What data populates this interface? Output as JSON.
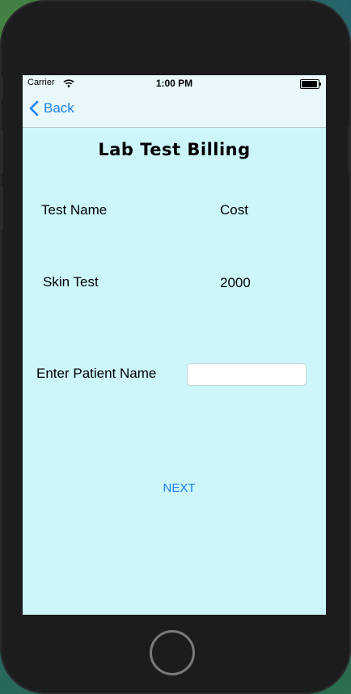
{
  "status_bar": {
    "carrier": "Carrier",
    "time": "1:00 PM"
  },
  "nav": {
    "back_label": "Back"
  },
  "screen": {
    "title": "Lab Test Billing",
    "headers": {
      "test_name": "Test Name",
      "cost": "Cost"
    },
    "row": {
      "test_name": "Skin Test",
      "cost": "2000"
    },
    "patient_label": "Enter Patient Name",
    "patient_input_value": "",
    "next_label": "NEXT"
  },
  "colors": {
    "accent": "#1a7ff2",
    "background": "#cdf6fb",
    "navbar": "#e9f8fa"
  },
  "icons": [
    "wifi-icon",
    "battery-icon",
    "chevron-left-icon"
  ]
}
